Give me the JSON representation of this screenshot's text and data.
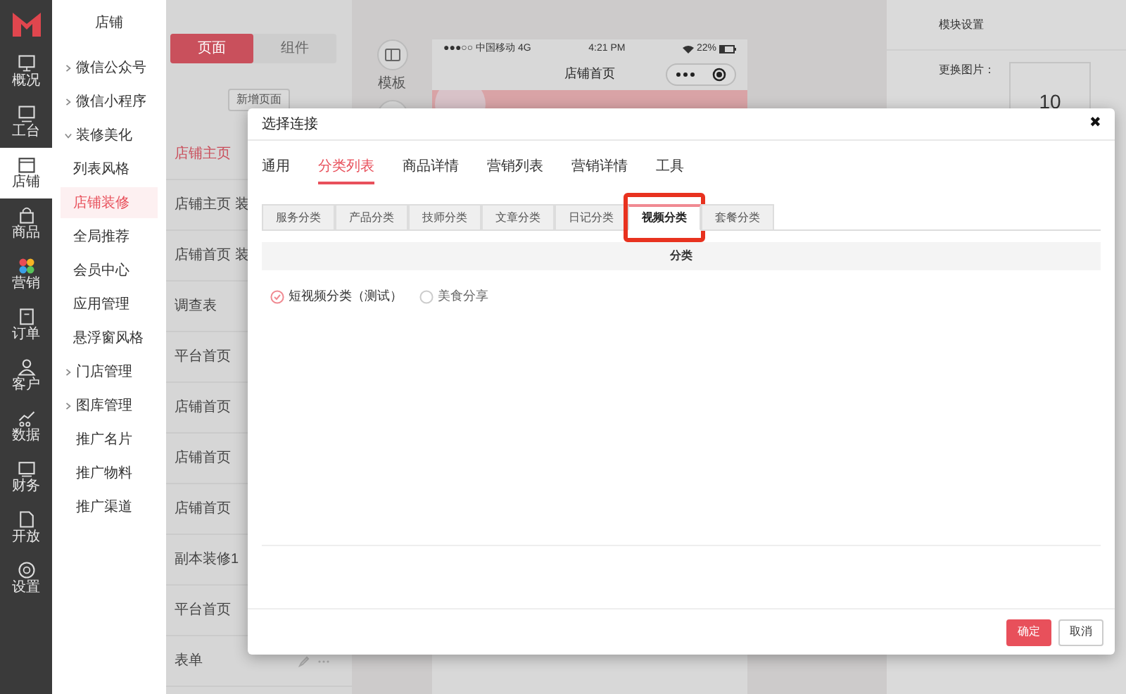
{
  "rail": [
    {
      "label": "概况",
      "selected": false
    },
    {
      "label": "工台",
      "selected": false
    },
    {
      "label": "店铺",
      "selected": true
    },
    {
      "label": "商品",
      "selected": false
    },
    {
      "label": "营销",
      "selected": false
    },
    {
      "label": "订单",
      "selected": false
    },
    {
      "label": "客户",
      "selected": false
    },
    {
      "label": "数据",
      "selected": false
    },
    {
      "label": "财务",
      "selected": false
    },
    {
      "label": "开放",
      "selected": false
    },
    {
      "label": "设置",
      "selected": false
    }
  ],
  "nav": {
    "title": "店铺",
    "items": [
      {
        "label": "微信公众号",
        "expanded": false,
        "selected": false
      },
      {
        "label": "微信小程序",
        "expanded": false,
        "selected": false
      },
      {
        "label": "装修美化",
        "expanded": true,
        "selected": false,
        "children": [
          {
            "label": "列表风格",
            "selected": false
          },
          {
            "label": "店铺装修",
            "selected": true
          },
          {
            "label": "全局推荐",
            "selected": false
          },
          {
            "label": "会员中心",
            "selected": false
          },
          {
            "label": "应用管理",
            "selected": false
          },
          {
            "label": "悬浮窗风格",
            "selected": false
          }
        ]
      },
      {
        "label": "门店管理",
        "expanded": false,
        "selected": false
      },
      {
        "label": "图库管理",
        "expanded": false,
        "selected": false
      },
      {
        "label": "推广名片",
        "selected": false
      },
      {
        "label": "推广物料",
        "selected": false
      },
      {
        "label": "推广渠道",
        "selected": false
      }
    ]
  },
  "pages_panel": {
    "tabs": [
      {
        "label": "页面",
        "selected": true
      },
      {
        "label": "组件",
        "selected": false
      }
    ],
    "add_button": "新增页面",
    "pages": [
      {
        "label": "店铺主页",
        "selected": true
      },
      {
        "label": "店铺主页 装",
        "selected": false
      },
      {
        "label": "店铺首页 装",
        "selected": false
      },
      {
        "label": "调查表",
        "selected": false
      },
      {
        "label": "平台首页",
        "selected": false
      },
      {
        "label": "店铺首页",
        "selected": false
      },
      {
        "label": "店铺首页",
        "selected": false
      },
      {
        "label": "店铺首页",
        "selected": false
      },
      {
        "label": "副本装修1",
        "selected": false
      },
      {
        "label": "平台首页",
        "selected": false
      },
      {
        "label": "表单",
        "selected": false
      }
    ]
  },
  "preview": {
    "template_label": "模板",
    "carrier": "●●●○○ 中国移动 4G",
    "time": "4:21 PM",
    "battery": "22%",
    "page_title": "店铺首页"
  },
  "settings": {
    "title": "模块设置",
    "image_label": "更换图片：",
    "image_text": "10"
  },
  "dialog": {
    "title": "选择连接",
    "close": "✖",
    "tabs": [
      {
        "label": "通用",
        "selected": false
      },
      {
        "label": "分类列表",
        "selected": true
      },
      {
        "label": "商品详情",
        "selected": false
      },
      {
        "label": "营销列表",
        "selected": false
      },
      {
        "label": "营销详情",
        "selected": false
      },
      {
        "label": "工具",
        "selected": false
      }
    ],
    "sub_tabs": [
      {
        "label": "服务分类",
        "selected": false,
        "highlighted": false
      },
      {
        "label": "产品分类",
        "selected": false,
        "highlighted": false
      },
      {
        "label": "技师分类",
        "selected": false,
        "highlighted": false
      },
      {
        "label": "文章分类",
        "selected": false,
        "highlighted": false
      },
      {
        "label": "日记分类",
        "selected": false,
        "highlighted": false
      },
      {
        "label": "视频分类",
        "selected": true,
        "highlighted": true
      },
      {
        "label": "套餐分类",
        "selected": false,
        "highlighted": false
      }
    ],
    "table": {
      "columns": [
        "分类"
      ]
    },
    "options": [
      {
        "label": "短视频分类（测试）",
        "selected": true
      },
      {
        "label": "美食分享",
        "selected": false
      }
    ],
    "buttons": [
      {
        "label": "确定",
        "kind": "primary"
      },
      {
        "label": "取消",
        "kind": "secondary"
      }
    ]
  }
}
